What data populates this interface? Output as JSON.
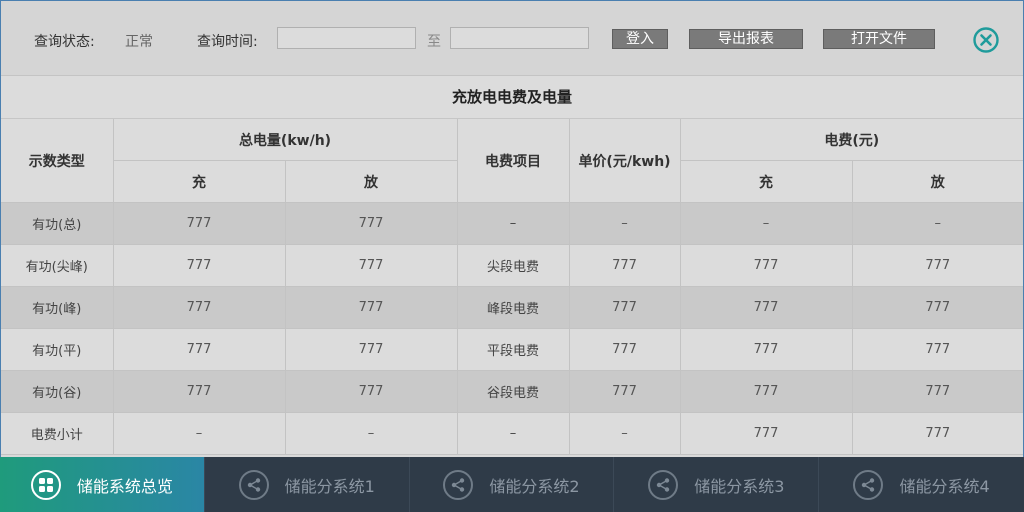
{
  "toolbar": {
    "status_label": "查询状态:",
    "status_value": "正常",
    "time_label": "查询时间:",
    "start_value": "",
    "separator": "至",
    "end_value": "",
    "login_button": "登入",
    "export_button": "导出报表",
    "open_file_button": "打开文件",
    "close_icon": "close-circle-icon",
    "accent_color": "#1f9b7c"
  },
  "table": {
    "title": "充放电电费及电量",
    "headers": {
      "type": "示数类型",
      "total_energy": "总电量(kw/h)",
      "item": "电费项目",
      "unit_price": "单价(元/kwh)",
      "fee": "电费(元)",
      "charge": "充",
      "discharge": "放"
    },
    "rows": [
      {
        "type": "有功(总)",
        "e_charge": "777",
        "e_discharge": "777",
        "item": "–",
        "price": "–",
        "f_charge": "–",
        "f_discharge": "–"
      },
      {
        "type": "有功(尖峰)",
        "e_charge": "777",
        "e_discharge": "777",
        "item": "尖段电费",
        "price": "777",
        "f_charge": "777",
        "f_discharge": "777"
      },
      {
        "type": "有功(峰)",
        "e_charge": "777",
        "e_discharge": "777",
        "item": "峰段电费",
        "price": "777",
        "f_charge": "777",
        "f_discharge": "777"
      },
      {
        "type": "有功(平)",
        "e_charge": "777",
        "e_discharge": "777",
        "item": "平段电费",
        "price": "777",
        "f_charge": "777",
        "f_discharge": "777"
      },
      {
        "type": "有功(谷)",
        "e_charge": "777",
        "e_discharge": "777",
        "item": "谷段电费",
        "price": "777",
        "f_charge": "777",
        "f_discharge": "777"
      },
      {
        "type": "电费小计",
        "e_charge": "–",
        "e_discharge": "–",
        "item": "–",
        "price": "–",
        "f_charge": "777",
        "f_discharge": "777"
      }
    ]
  },
  "nav": {
    "items": [
      {
        "label": "储能系统总览",
        "icon": "grid-icon",
        "active": true
      },
      {
        "label": "储能分系统1",
        "icon": "share-icon",
        "active": false
      },
      {
        "label": "储能分系统2",
        "icon": "share-icon",
        "active": false
      },
      {
        "label": "储能分系统3",
        "icon": "share-icon",
        "active": false
      },
      {
        "label": "储能分系统4",
        "icon": "share-icon",
        "active": false
      }
    ]
  }
}
